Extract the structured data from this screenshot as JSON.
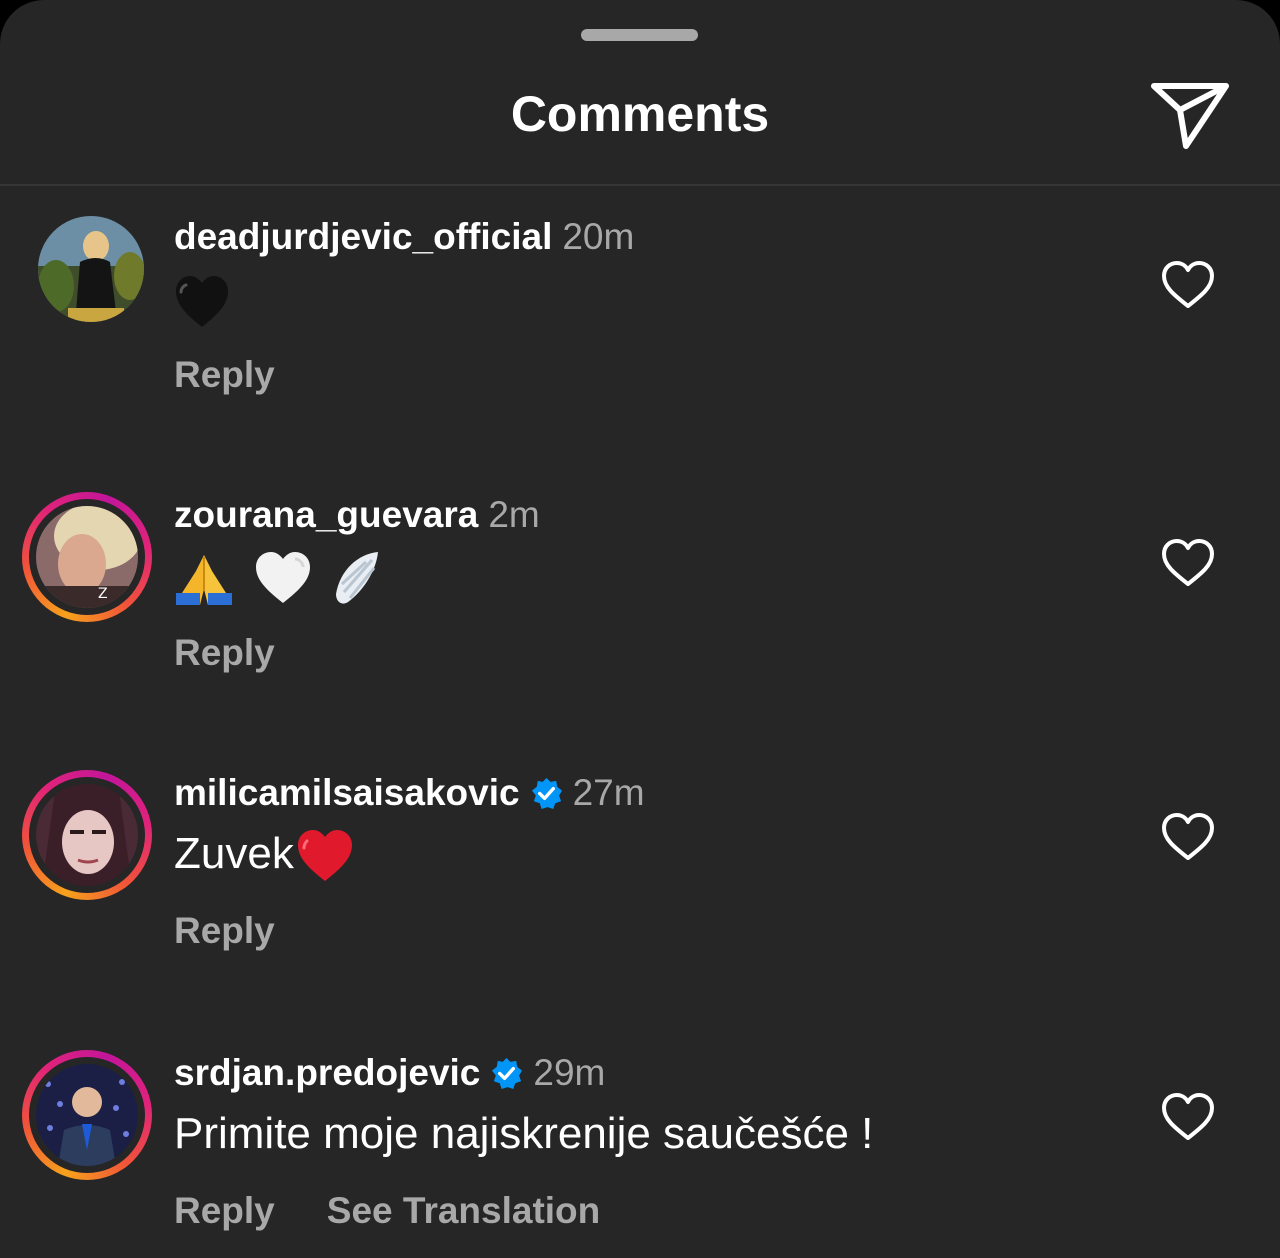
{
  "header": {
    "title": "Comments",
    "send_icon": "paper-plane-icon"
  },
  "comments": [
    {
      "username": "deadjurdjevic_official",
      "time": "20m",
      "verified": false,
      "story_ring": false,
      "text": "",
      "emojis": [
        "black-heart-emoji"
      ],
      "reply_label": "Reply",
      "like_icon": "heart-outline-icon"
    },
    {
      "username": "zourana_guevara",
      "time": "2m",
      "verified": false,
      "story_ring": true,
      "text": "",
      "emojis": [
        "folded-hands-emoji",
        "white-heart-emoji",
        "wing-emoji"
      ],
      "reply_label": "Reply",
      "like_icon": "heart-outline-icon"
    },
    {
      "username": "milicamilsaisakovic",
      "time": "27m",
      "verified": true,
      "story_ring": true,
      "text": "Zuvek",
      "emojis": [
        "red-heart-emoji"
      ],
      "reply_label": "Reply",
      "like_icon": "heart-outline-icon"
    },
    {
      "username": "srdjan.predojevic",
      "time": "29m",
      "verified": true,
      "story_ring": true,
      "text": "Primite moje najiskrenije saučešće !",
      "emojis": [],
      "reply_label": "Reply",
      "translation_label": "See Translation",
      "like_icon": "heart-outline-icon"
    }
  ],
  "colors": {
    "background": "#262626",
    "secondary_text": "#a8a8a8",
    "verified": "#0095f6",
    "red_heart": "#e0192d"
  }
}
